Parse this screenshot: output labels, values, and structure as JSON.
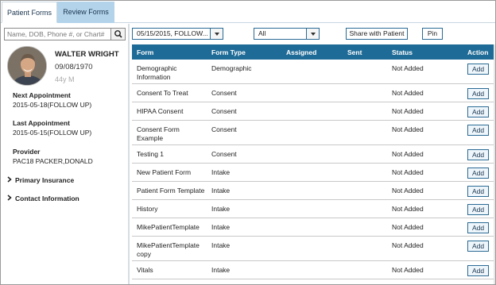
{
  "tabs": [
    {
      "label": "Patient Forms"
    },
    {
      "label": "Review Forms"
    }
  ],
  "search": {
    "placeholder": "Name, DOB, Phone #, or Chart#"
  },
  "patient": {
    "name": "WALTER WRIGHT",
    "dob": "09/08/1970",
    "age_sex": "44y M",
    "next_appt_label": "Next Appointment",
    "next_appt_value": "2015-05-18(FOLLOW UP)",
    "last_appt_label": "Last Appointment",
    "last_appt_value": "2015-05-15(FOLLOW UP)",
    "provider_label": "Provider",
    "provider_value": "PAC18 PACKER,DONALD",
    "primary_insurance": "Primary Insurance",
    "contact_information": "Contact Information"
  },
  "toolbar": {
    "appointment_select": "05/15/2015, FOLLOW...",
    "filter_select": "All",
    "share_label": "Share with Patient",
    "pin_label": "Pin"
  },
  "table": {
    "headers": [
      "Form",
      "Form Type",
      "Assigned",
      "Sent",
      "Status",
      "Action"
    ],
    "rows": [
      {
        "form": "Demographic Information",
        "type": "Demographic",
        "status": "Not Added",
        "action": "Add"
      },
      {
        "form": "Consent To Treat",
        "type": "Consent",
        "status": "Not Added",
        "action": "Add"
      },
      {
        "form": "HIPAA Consent",
        "type": "Consent",
        "status": "Not Added",
        "action": "Add"
      },
      {
        "form": "Consent Form Example",
        "type": "Consent",
        "status": "Not Added",
        "action": "Add"
      },
      {
        "form": "Testing 1",
        "type": "Consent",
        "status": "Not Added",
        "action": "Add"
      },
      {
        "form": "New Patient Form",
        "type": "Intake",
        "status": "Not Added",
        "action": "Add"
      },
      {
        "form": "Patient Form Template",
        "type": "Intake",
        "status": "Not Added",
        "action": "Add"
      },
      {
        "form": "History",
        "type": "Intake",
        "status": "Not Added",
        "action": "Add"
      },
      {
        "form": "MikePatientTemplate",
        "type": "Intake",
        "status": "Not Added",
        "action": "Add"
      },
      {
        "form": "MikePatientTemplate copy",
        "type": "Intake",
        "status": "Not Added",
        "action": "Add"
      },
      {
        "form": "Vitals",
        "type": "Intake",
        "status": "Not Added",
        "action": "Add"
      }
    ]
  },
  "colors": {
    "header": "#1f6b97",
    "tab_inactive": "#b3d3ea",
    "border_accent": "#2a6a94"
  }
}
